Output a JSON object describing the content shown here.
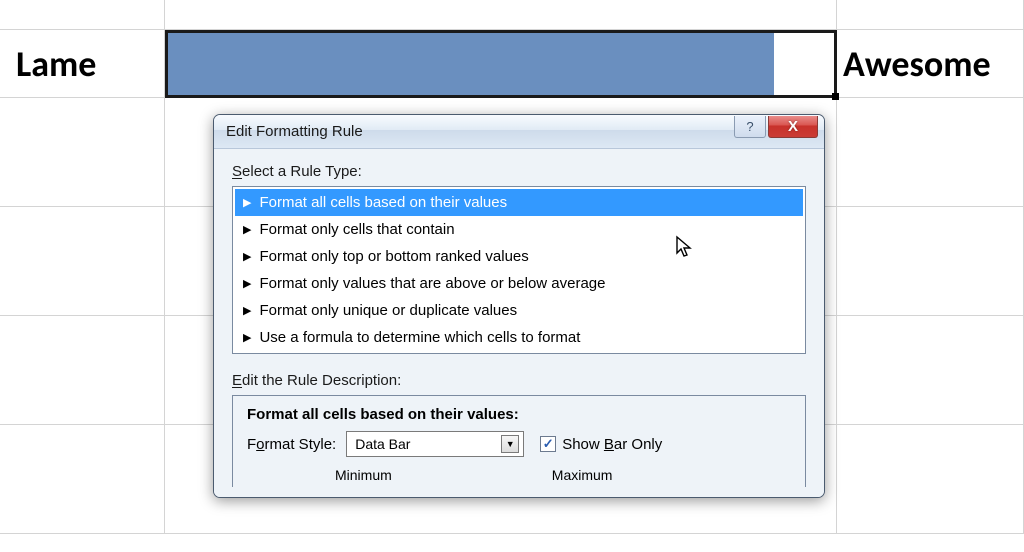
{
  "spreadsheet": {
    "labelLeft": "Lame",
    "labelRight": "Awesome",
    "barFillPercent": 91
  },
  "dialog": {
    "title": "Edit Formatting Rule",
    "helpGlyph": "?",
    "closeGlyph": "X",
    "ruleTypeLabel": "Select a Rule Type:",
    "ruleTypeLabelAccel": "S",
    "rules": [
      "Format all cells based on their values",
      "Format only cells that contain",
      "Format only top or bottom ranked values",
      "Format only values that are above or below average",
      "Format only unique or duplicate values",
      "Use a formula to determine which cells to format"
    ],
    "selectedRuleIndex": 0,
    "descLabel": "Edit the Rule Description:",
    "descLabelAccel": "E",
    "descTitle": "Format all cells based on their values:",
    "formatStyleLabel": "Format Style:",
    "formatStyleAccel": "o",
    "formatStyleValue": "Data Bar",
    "showBarOnlyLabel": "Show Bar Only",
    "showBarOnlyAccel": "B",
    "showBarOnlyChecked": true,
    "minLabel": "Minimum",
    "maxLabel": "Maximum"
  }
}
